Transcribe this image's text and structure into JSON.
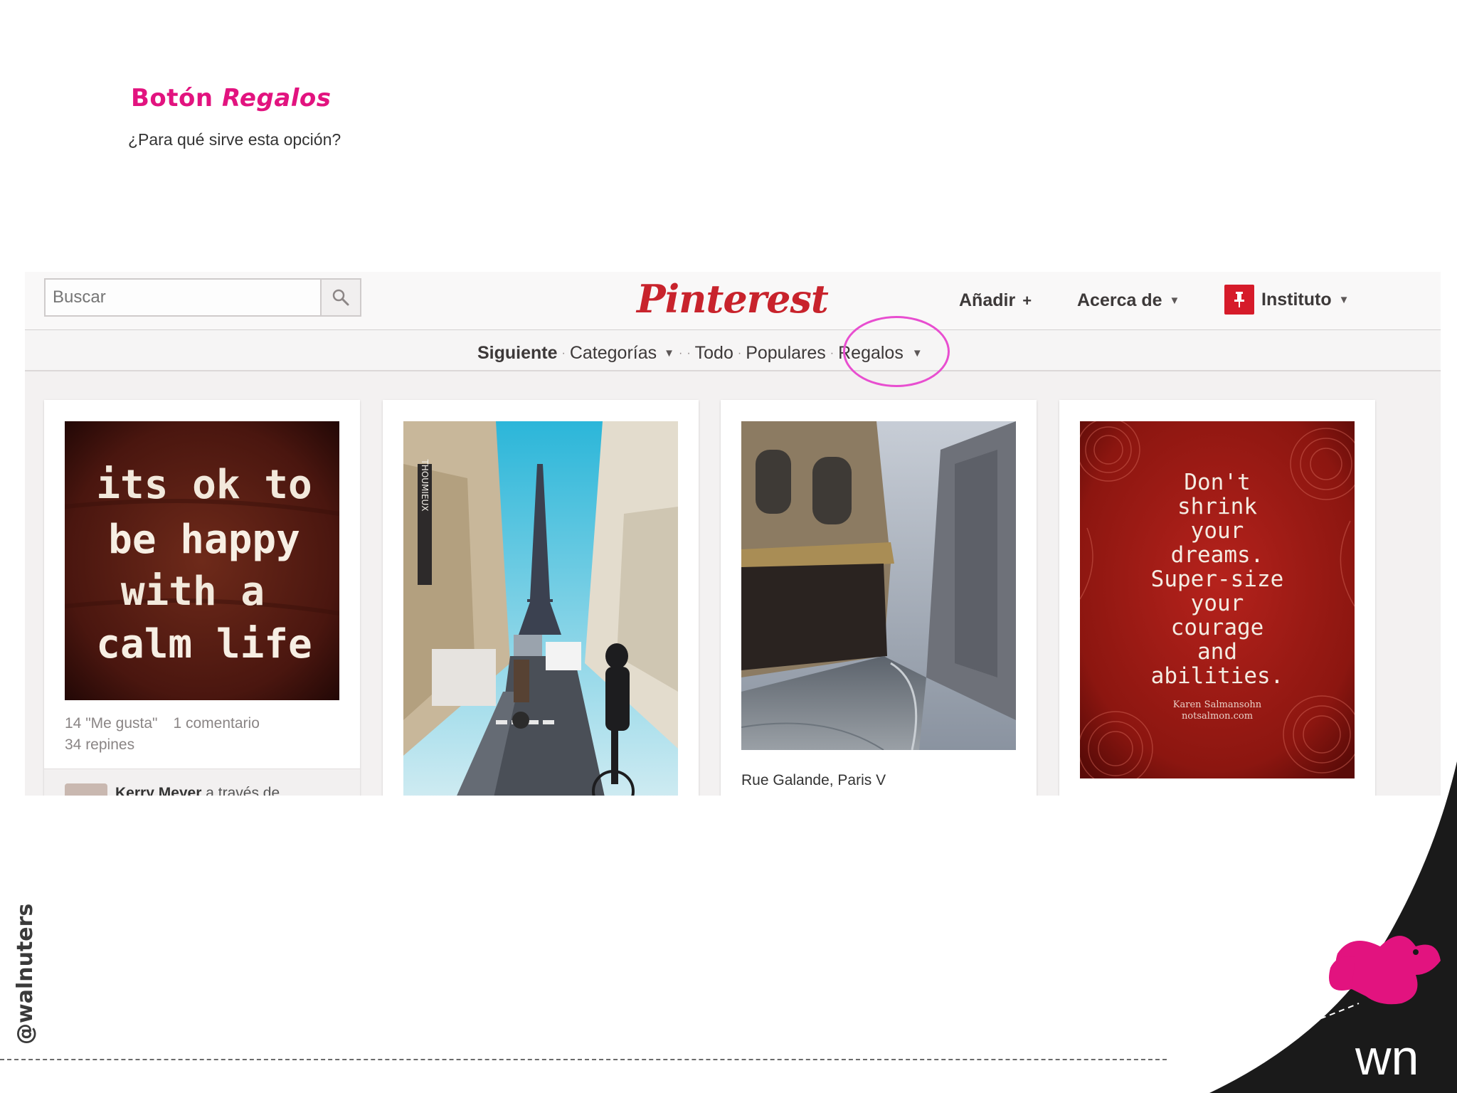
{
  "slide": {
    "title_prefix": "Botón",
    "title_emphasis": "Regalos",
    "subtitle": "¿Para qué sirve esta opción?",
    "handle": "@walnuters",
    "brand_mark": "wn"
  },
  "colors": {
    "accent": "#e2137f",
    "pinterest_red": "#c8232c",
    "highlight": "#e84ed0"
  },
  "header": {
    "search_placeholder": "Buscar",
    "logo": "Pinterest",
    "add_label": "Añadir",
    "add_icon": "+",
    "about_label": "Acerca de",
    "user_label": "Instituto"
  },
  "subnav": {
    "following": "Siguiente",
    "categories": "Categorías",
    "all": "Todo",
    "popular": "Populares",
    "gifts": "Regalos"
  },
  "pins": [
    {
      "image_text": [
        "its ok to",
        "be happy",
        "with a",
        "calm life"
      ],
      "likes": "14 \"Me gusta\"",
      "comments": "1 comentario",
      "repins": "34 repines",
      "footer_user": "Kerry Meyer",
      "footer_via": "a través de"
    },
    {
      "sign_text": "THOUMIEUX"
    },
    {
      "caption": "Rue Galande, Paris V"
    },
    {
      "image_text": [
        "Don't",
        "shrink",
        "your",
        "dreams.",
        "Super-size",
        "your",
        "courage",
        "and",
        "abilities."
      ],
      "credit_1": "Karen Salmansohn",
      "credit_2": "notsalmon.com"
    }
  ]
}
